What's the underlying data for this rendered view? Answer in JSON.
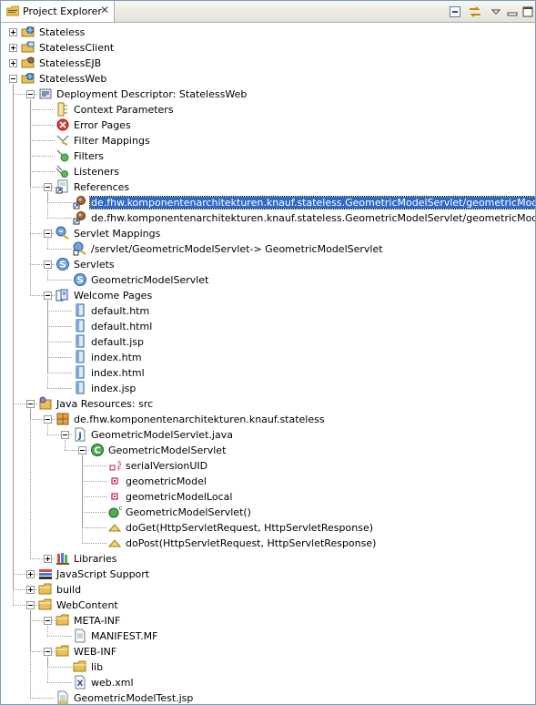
{
  "view": {
    "title": "Project Explorer",
    "toolbar": [
      "collapse-all-icon",
      "link-with-editor-icon",
      "view-menu-icon",
      "minimize-icon",
      "maximize-icon"
    ]
  },
  "tree": [
    {
      "label": "Stateless",
      "icon": "web-project-icon",
      "depth": 0,
      "toggle": "collapsed"
    },
    {
      "label": "StatelessClient",
      "icon": "app-client-project-icon",
      "depth": 0,
      "toggle": "collapsed"
    },
    {
      "label": "StatelessEJB",
      "icon": "ejb-project-icon",
      "depth": 0,
      "toggle": "collapsed"
    },
    {
      "label": "StatelessWeb",
      "icon": "web-project-icon",
      "depth": 0,
      "toggle": "expanded"
    },
    {
      "label": "Deployment Descriptor: StatelessWeb",
      "icon": "deployment-descriptor-icon",
      "depth": 1,
      "toggle": "expanded"
    },
    {
      "label": "Context Parameters",
      "icon": "context-params-icon",
      "depth": 2,
      "toggle": "none"
    },
    {
      "label": "Error Pages",
      "icon": "error-pages-icon",
      "depth": 2,
      "toggle": "none"
    },
    {
      "label": "Filter Mappings",
      "icon": "filter-mappings-icon",
      "depth": 2,
      "toggle": "none"
    },
    {
      "label": "Filters",
      "icon": "filters-icon",
      "depth": 2,
      "toggle": "none"
    },
    {
      "label": "Listeners",
      "icon": "listeners-icon",
      "depth": 2,
      "toggle": "none"
    },
    {
      "label": "References",
      "icon": "references-icon",
      "depth": 2,
      "toggle": "expanded"
    },
    {
      "label": "de.fhw.komponentenarchitekturen.knauf.stateless.GeometricModelServlet/geometricModel",
      "icon": "ejb-reference-icon",
      "depth": 3,
      "toggle": "none",
      "selected": true
    },
    {
      "label": "de.fhw.komponentenarchitekturen.knauf.stateless.GeometricModelServlet/geometricModelLocal",
      "icon": "ejb-reference-icon",
      "depth": 3,
      "toggle": "none"
    },
    {
      "label": "Servlet Mappings",
      "icon": "servlet-mappings-icon",
      "depth": 2,
      "toggle": "expanded"
    },
    {
      "label": "/servlet/GeometricModelServlet-> GeometricModelServlet",
      "icon": "servlet-mapping-icon",
      "depth": 3,
      "toggle": "none"
    },
    {
      "label": "Servlets",
      "icon": "servlets-icon",
      "depth": 2,
      "toggle": "expanded"
    },
    {
      "label": "GeometricModelServlet",
      "icon": "servlet-icon",
      "depth": 3,
      "toggle": "none"
    },
    {
      "label": "Welcome Pages",
      "icon": "welcome-pages-icon",
      "depth": 2,
      "toggle": "expanded"
    },
    {
      "label": "default.htm",
      "icon": "welcome-file-icon",
      "depth": 3,
      "toggle": "none"
    },
    {
      "label": "default.html",
      "icon": "welcome-file-icon",
      "depth": 3,
      "toggle": "none"
    },
    {
      "label": "default.jsp",
      "icon": "welcome-file-icon",
      "depth": 3,
      "toggle": "none"
    },
    {
      "label": "index.htm",
      "icon": "welcome-file-icon",
      "depth": 3,
      "toggle": "none"
    },
    {
      "label": "index.html",
      "icon": "welcome-file-icon",
      "depth": 3,
      "toggle": "none"
    },
    {
      "label": "index.jsp",
      "icon": "welcome-file-icon",
      "depth": 3,
      "toggle": "none"
    },
    {
      "label": "Java Resources: src",
      "icon": "java-resources-icon",
      "depth": 1,
      "toggle": "expanded"
    },
    {
      "label": "de.fhw.komponentenarchitekturen.knauf.stateless",
      "icon": "package-icon",
      "depth": 2,
      "toggle": "expanded"
    },
    {
      "label": "GeometricModelServlet.java",
      "icon": "java-file-icon",
      "depth": 3,
      "toggle": "expanded"
    },
    {
      "label": "GeometricModelServlet",
      "icon": "class-icon",
      "depth": 4,
      "toggle": "expanded"
    },
    {
      "label": "serialVersionUID",
      "icon": "static-final-field-icon",
      "depth": 5,
      "toggle": "none"
    },
    {
      "label": "geometricModel",
      "icon": "private-field-icon",
      "depth": 5,
      "toggle": "none"
    },
    {
      "label": "geometricModelLocal",
      "icon": "private-field-icon",
      "depth": 5,
      "toggle": "none"
    },
    {
      "label": "GeometricModelServlet()",
      "icon": "constructor-icon",
      "depth": 5,
      "toggle": "none"
    },
    {
      "label": "doGet(HttpServletRequest, HttpServletResponse)",
      "icon": "protected-method-icon",
      "depth": 5,
      "toggle": "none"
    },
    {
      "label": "doPost(HttpServletRequest, HttpServletResponse)",
      "icon": "protected-method-icon",
      "depth": 5,
      "toggle": "none"
    },
    {
      "label": "Libraries",
      "icon": "libraries-icon",
      "depth": 2,
      "toggle": "collapsed"
    },
    {
      "label": "JavaScript Support",
      "icon": "javascript-support-icon",
      "depth": 1,
      "toggle": "collapsed"
    },
    {
      "label": "build",
      "icon": "folder-icon",
      "depth": 1,
      "toggle": "collapsed"
    },
    {
      "label": "WebContent",
      "icon": "folder-icon",
      "depth": 1,
      "toggle": "expanded"
    },
    {
      "label": "META-INF",
      "icon": "folder-icon",
      "depth": 2,
      "toggle": "expanded"
    },
    {
      "label": "MANIFEST.MF",
      "icon": "file-icon",
      "depth": 3,
      "toggle": "none"
    },
    {
      "label": "WEB-INF",
      "icon": "folder-icon",
      "depth": 2,
      "toggle": "expanded"
    },
    {
      "label": "lib",
      "icon": "folder-icon",
      "depth": 3,
      "toggle": "none"
    },
    {
      "label": "web.xml",
      "icon": "xml-file-icon",
      "depth": 3,
      "toggle": "none"
    },
    {
      "label": "GeometricModelTest.jsp",
      "icon": "jsp-file-icon",
      "depth": 2,
      "toggle": "none"
    }
  ],
  "colors": {
    "selection": "#316ac5",
    "folder": "#e8c057",
    "border": "#7f9db9"
  }
}
